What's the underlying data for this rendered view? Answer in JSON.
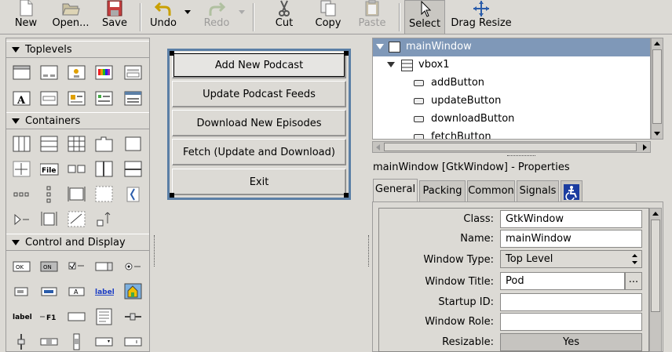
{
  "toolbar": {
    "new": "New",
    "open": "Open...",
    "save": "Save",
    "undo": "Undo",
    "redo": "Redo",
    "cut": "Cut",
    "copy": "Copy",
    "paste": "Paste",
    "select": "Select",
    "drag_resize": "Drag Resize"
  },
  "palette": {
    "toplevels": "Toplevels",
    "containers": "Containers",
    "control_display": "Control and Display",
    "widget_labels": {
      "file": "File",
      "label": "label",
      "label_plain": "label",
      "f1": "F1",
      "ok": "OK",
      "on": "ON",
      "a": "A"
    }
  },
  "design": {
    "buttons": [
      "Add New Podcast",
      "Update Podcast Feeds",
      "Download New Episodes",
      "Fetch (Update and Download)",
      "Exit"
    ]
  },
  "tree": {
    "rows": [
      {
        "label": "mainWindow"
      },
      {
        "label": "vbox1"
      },
      {
        "label": "addButton"
      },
      {
        "label": "updateButton"
      },
      {
        "label": "downloadButton"
      },
      {
        "label": "fetchButton"
      }
    ]
  },
  "properties": {
    "title": "mainWindow [GtkWindow] - Properties",
    "tabs": [
      "General",
      "Packing",
      "Common",
      "Signals"
    ],
    "fields": [
      {
        "label": "Class:",
        "value": "GtkWindow"
      },
      {
        "label": "Name:",
        "value": "mainWindow"
      },
      {
        "label": "Window Type:",
        "value": "Top Level"
      },
      {
        "label": "Window Title:",
        "value": "Pod"
      },
      {
        "label": "Startup ID:",
        "value": ""
      },
      {
        "label": "Window Role:",
        "value": ""
      },
      {
        "label": "Resizable:",
        "value": "Yes"
      }
    ],
    "ellipsis": "..."
  },
  "colors": {
    "selection": "#7f98b8",
    "window_border": "#5b7fa6",
    "background": "#dcdad5"
  }
}
